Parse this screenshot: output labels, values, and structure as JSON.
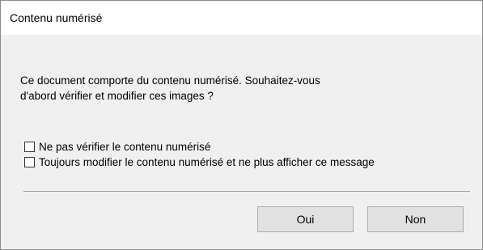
{
  "window": {
    "title": "Contenu numérisé"
  },
  "message": {
    "line1": "Ce document comporte du contenu numérisé. Souhaitez-vous",
    "line2": "d'abord vérifier et modifier ces images ?"
  },
  "options": [
    {
      "label": "Ne pas vérifier le contenu numérisé",
      "checked": false
    },
    {
      "label": "Toujours modifier le contenu numérisé et ne plus afficher ce message",
      "checked": false
    }
  ],
  "buttons": {
    "yes_label": "Oui",
    "no_label": "Non"
  }
}
